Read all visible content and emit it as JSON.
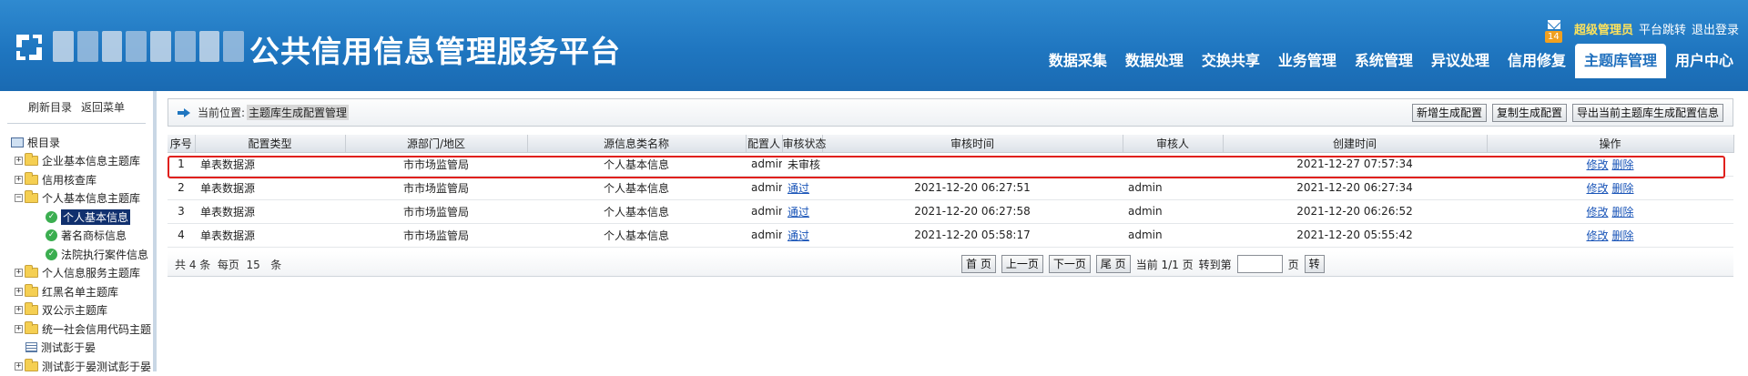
{
  "header": {
    "title": "公共信用信息管理服务平台",
    "mail_badge": "14",
    "user_name": "超级管理员",
    "link_switch": "平台跳转",
    "link_logout": "退出登录",
    "nav": [
      "数据采集",
      "数据处理",
      "交换共享",
      "业务管理",
      "系统管理",
      "异议处理",
      "信用修复",
      "主题库管理",
      "用户中心"
    ],
    "nav_active_index": 7,
    "accent_color": "#1f76c0",
    "user_color": "#ffe35a"
  },
  "sidebar": {
    "refresh_label": "刷新目录",
    "back_label": "返回菜单",
    "root_label": "根目录",
    "items": [
      {
        "label": "企业基本信息主题库",
        "expander": "+",
        "icon": "folder-icon"
      },
      {
        "label": "信用核查库",
        "expander": "+",
        "icon": "folder-icon"
      },
      {
        "label": "个人基本信息主题库",
        "expander": "−",
        "icon": "folder-icon"
      },
      {
        "label": "个人基本信息",
        "icon": "check-icon",
        "selected": true
      },
      {
        "label": "著名商标信息",
        "icon": "check-icon"
      },
      {
        "label": "法院执行案件信息",
        "icon": "check-icon"
      },
      {
        "label": "个人信息服务主题库",
        "expander": "+",
        "icon": "folder-icon"
      },
      {
        "label": "红黑名单主题库",
        "expander": "+",
        "icon": "folder-icon"
      },
      {
        "label": "双公示主题库",
        "expander": "+",
        "icon": "folder-icon"
      },
      {
        "label": "统一社会信用代码主题",
        "expander": "+",
        "icon": "folder-icon"
      },
      {
        "label": "测试彭于晏",
        "icon": "document-icon"
      },
      {
        "label": "测试彭于晏测试彭于晏",
        "expander": "+",
        "icon": "folder-icon"
      }
    ]
  },
  "main": {
    "crumb_label": "当前位置:",
    "crumb_value": "主题库生成配置管理",
    "buttons": [
      "新增生成配置",
      "复制生成配置",
      "导出当前主题库生成配置信息"
    ],
    "table": {
      "headers": [
        "序号",
        "配置类型",
        "源部门/地区",
        "源信息类名称",
        "配置人",
        "审核状态",
        "审核时间",
        "审核人",
        "创建时间",
        "操作"
      ],
      "rows": [
        {
          "no": "1",
          "type": "单表数据源",
          "dept": "市市场监管局",
          "source": "个人基本信息",
          "person": "admin",
          "status": "未审核",
          "status_link": false,
          "review_time": "",
          "reviewer": "",
          "created": "2021-12-27 07:57:34",
          "edit": "修改",
          "delete": "删除"
        },
        {
          "no": "2",
          "type": "单表数据源",
          "dept": "市市场监管局",
          "source": "个人基本信息",
          "person": "admin",
          "status": "通过",
          "status_link": true,
          "review_time": "2021-12-20 06:27:51",
          "reviewer": "admin",
          "created": "2021-12-20 06:27:34",
          "edit": "修改",
          "delete": "删除"
        },
        {
          "no": "3",
          "type": "单表数据源",
          "dept": "市市场监管局",
          "source": "个人基本信息",
          "person": "admin",
          "status": "通过",
          "status_link": true,
          "review_time": "2021-12-20 06:27:58",
          "reviewer": "admin",
          "created": "2021-12-20 06:26:52",
          "edit": "修改",
          "delete": "删除"
        },
        {
          "no": "4",
          "type": "单表数据源",
          "dept": "市市场监管局",
          "source": "个人基本信息",
          "person": "admin",
          "status": "通过",
          "status_link": true,
          "review_time": "2021-12-20 05:58:17",
          "reviewer": "admin",
          "created": "2021-12-20 05:55:42",
          "edit": "修改",
          "delete": "删除"
        }
      ]
    },
    "pager": {
      "summary": "共 4 条  每页  15   条",
      "first": "首 页",
      "prev": "上一页",
      "next": "下一页",
      "last": "尾 页",
      "current": "当前 1/1 页",
      "goto_label": "转到第",
      "page_unit": "页",
      "go": "转",
      "goto_value": ""
    },
    "highlight_color": "#e0201c"
  }
}
